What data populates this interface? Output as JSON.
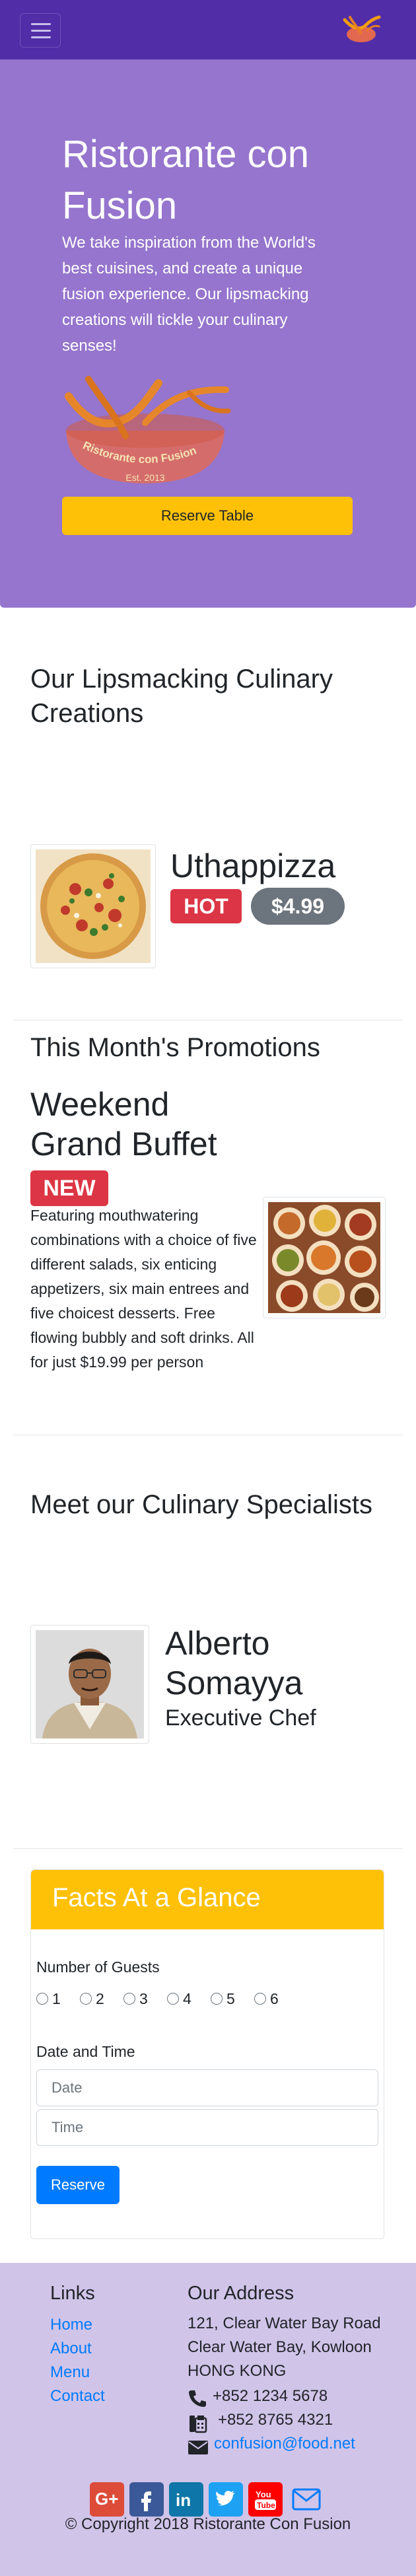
{
  "navbar": {
    "toggler_icon": "hamburger-icon",
    "logo_icon": "brand-logo-icon"
  },
  "hero": {
    "title": "Ristorante con Fusion",
    "text": "We take inspiration from the World's best cuisines, and create a unique fusion experience. Our lipsmacking creations will tickle your culinary senses!",
    "logo_text": "Ristorante con Fusion",
    "logo_est": "Est. 2013",
    "reserve_label": "Reserve Table"
  },
  "creations": {
    "heading": "Our Lipsmacking Culinary Creations",
    "dish": {
      "name": "Uthappizza",
      "badge": "HOT",
      "price": "$4.99"
    }
  },
  "promotions": {
    "heading": "This Month's Promotions",
    "title": "Weekend Grand Buffet",
    "badge": "NEW",
    "description": "Featuring mouthwatering combinations with a choice of five different salads, six enticing appetizers, six main entrees and five choicest desserts. Free flowing bubbly and soft drinks. All for just $19.99 per person"
  },
  "specialists": {
    "heading": "Meet our Culinary Specialists",
    "name": "Alberto Somayya",
    "role": "Executive Chef"
  },
  "facts": {
    "title": "Facts At a Glance",
    "guests_label": "Number of Guests",
    "guest_options": [
      "1",
      "2",
      "3",
      "4",
      "5",
      "6"
    ],
    "date_time_label": "Date and Time",
    "date_placeholder": "Date",
    "time_placeholder": "Time",
    "submit_label": "Reserve"
  },
  "footer": {
    "links_heading": "Links",
    "links": [
      "Home",
      "About",
      "Menu",
      "Contact"
    ],
    "address_heading": "Our Address",
    "address_lines": [
      "121, Clear Water Bay Road",
      "Clear Water Bay, Kowloon",
      "HONG KONG"
    ],
    "phone": "+852 1234 5678",
    "fax": "+852 8765 4321",
    "email": "confusion@food.net",
    "social_icons": [
      "google-plus-icon",
      "facebook-icon",
      "linkedin-icon",
      "twitter-icon",
      "youtube-icon",
      "mail-icon"
    ],
    "copyright": "© Copyright 2018 Ristorante Con Fusion"
  },
  "colors": {
    "navbar": "#512da8",
    "jumbotron": "#9575cd",
    "footer": "#d1c4e9",
    "warning": "#ffc107",
    "danger": "#dc3545",
    "secondary": "#6c757d",
    "primary": "#007bff"
  }
}
